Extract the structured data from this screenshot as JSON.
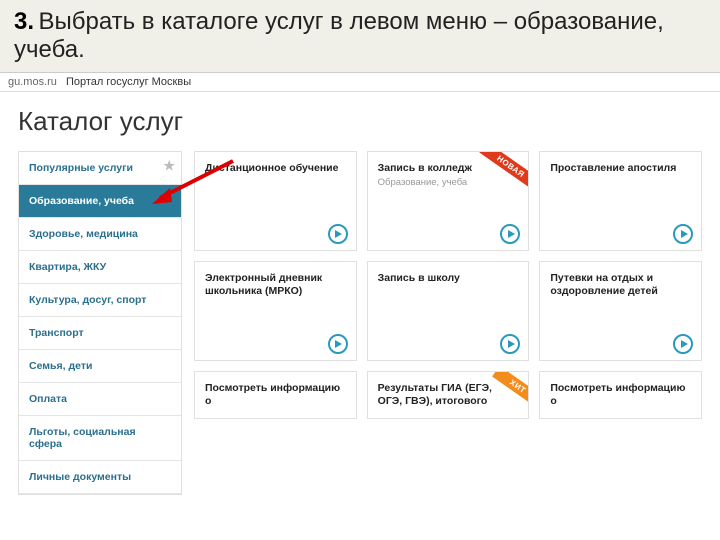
{
  "instruction": {
    "num": "3.",
    "text": "Выбрать в каталоге услуг в левом меню – образование, учеба."
  },
  "browser": {
    "url": "gu.mos.ru",
    "site": "Портал госуслуг Москвы"
  },
  "page_title": "Каталог услуг",
  "sidebar": {
    "items": [
      {
        "label": "Популярные услуги"
      },
      {
        "label": "Образование, учеба"
      },
      {
        "label": "Здоровье, медицина"
      },
      {
        "label": "Квартира, ЖКУ"
      },
      {
        "label": "Культура, досуг, спорт"
      },
      {
        "label": "Транспорт"
      },
      {
        "label": "Семья, дети"
      },
      {
        "label": "Оплата"
      },
      {
        "label": "Льготы, социальная сфера"
      },
      {
        "label": "Личные документы"
      }
    ]
  },
  "cards": {
    "row1": [
      {
        "title": "Дистанционное обучение",
        "sub": ""
      },
      {
        "title": "Запись в колледж",
        "sub": "Образование, учеба",
        "ribbon": "НОВАЯ"
      },
      {
        "title": "Проставление апостиля",
        "sub": ""
      }
    ],
    "row2": [
      {
        "title": "Электронный дневник школьника (МРКО)",
        "sub": ""
      },
      {
        "title": "Запись в школу",
        "sub": ""
      },
      {
        "title": "Путевки на отдых и оздоровление детей",
        "sub": ""
      }
    ],
    "row3": [
      {
        "title": "Посмотреть информацию о"
      },
      {
        "title": "Результаты ГИА (ЕГЭ, ОГЭ, ГВЭ), итогового",
        "ribbon": "ХИТ"
      },
      {
        "title": "Посмотреть информацию о"
      }
    ]
  }
}
